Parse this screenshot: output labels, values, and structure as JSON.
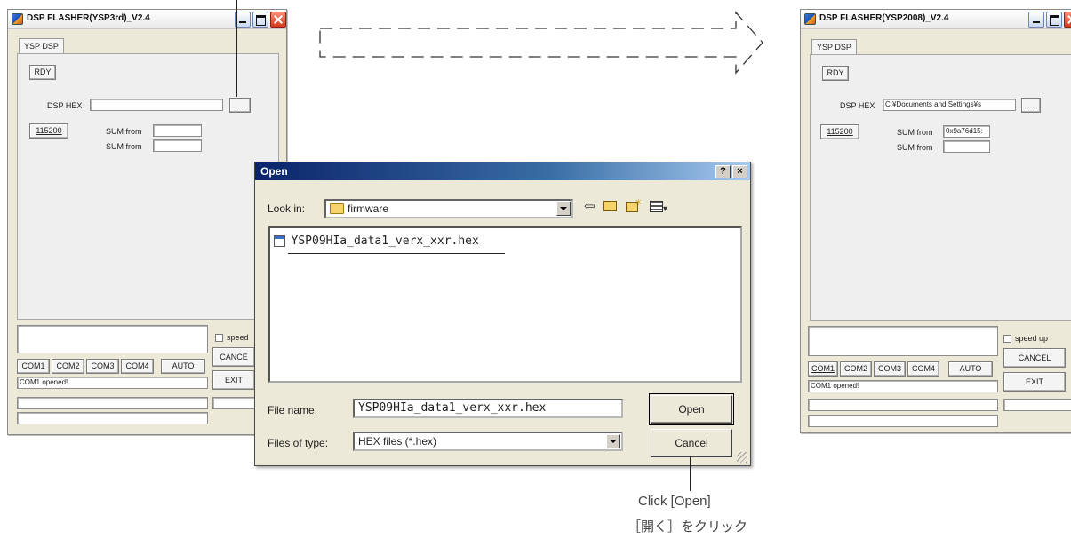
{
  "left_window": {
    "title": "DSP FLASHER(YSP3rd)_V2.4",
    "tab": "YSP DSP",
    "rdy": "RDY",
    "dsp_hex_label": "DSP HEX",
    "dsp_hex_value": "",
    "browse": "...",
    "baud": "115200",
    "sum_label_1": "SUM from",
    "sum_label_2": "SUM from",
    "sum_value_1": "",
    "sum_value_2": "",
    "speed_up": "speed",
    "cancel": "CANCE",
    "exit": "EXIT",
    "com_buttons": [
      "COM1",
      "COM2",
      "COM3",
      "COM4",
      "AUTO"
    ],
    "status": "COM1 opened!"
  },
  "right_window": {
    "title": "DSP FLASHER(YSP2008)_V2.4",
    "tab": "YSP DSP",
    "rdy": "RDY",
    "dsp_hex_label": "DSP HEX",
    "dsp_hex_value": "C:¥Documents and Settings¥s",
    "browse": "...",
    "baud": "115200",
    "sum_label_1": "SUM from",
    "sum_label_2": "SUM from",
    "sum_value_1": "0x9a76d15:",
    "sum_value_2": "",
    "speed_up": "speed up",
    "cancel": "CANCEL",
    "exit": "EXIT",
    "com_buttons": [
      "COM1",
      "COM2",
      "COM3",
      "COM4",
      "AUTO"
    ],
    "status": "COM1 opened!"
  },
  "open_dialog": {
    "title": "Open",
    "help": "?",
    "close": "×",
    "look_in_label": "Look in:",
    "look_in_value": "firmware",
    "files": [
      "YSP09HIa_data1_verx_xxr.hex"
    ],
    "file_name_label": "File name:",
    "file_name_value": "YSP09HIa_data1_verx_xxr.hex",
    "files_of_type_label": "Files of type:",
    "files_of_type_value": "HEX files (*.hex)",
    "open_button": "Open",
    "cancel_button": "Cancel",
    "icons": [
      "back-arrow-icon",
      "up-folder-icon",
      "new-folder-icon",
      "view-menu-icon"
    ]
  },
  "callout": {
    "line1": "Click [Open]",
    "line2": "［開く］をクリック"
  },
  "colors": {
    "dialog_titlebar": "#0a246a",
    "window_face": "#ece9d8",
    "close_button": "#d33a1c"
  }
}
